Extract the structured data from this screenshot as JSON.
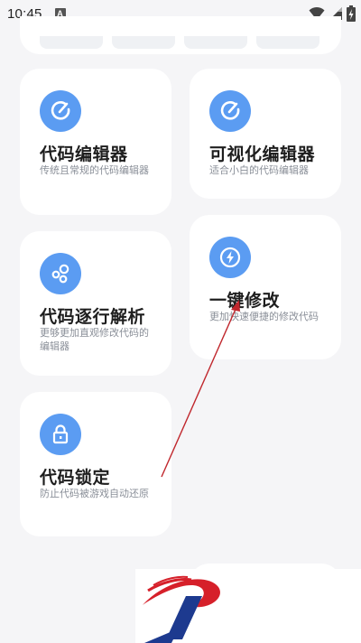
{
  "status_bar": {
    "time": "10:45",
    "notification_badge": "A",
    "icons": [
      "wifi-icon",
      "signal-icon",
      "battery-charging-icon"
    ]
  },
  "cards": [
    {
      "title": "代码编辑器",
      "description": "传统且常规的代码编辑器",
      "icon": "edit-icon"
    },
    {
      "title": "可视化编辑器",
      "description": "适合小白的代码编辑器",
      "icon": "edit-icon"
    },
    {
      "title": "代码逐行解析",
      "description": "更够更加直观修改代码的编辑器",
      "icon": "bubbles-icon"
    },
    {
      "title": "一键修改",
      "description": "更加快速便捷的修改代码",
      "icon": "lightning-icon"
    },
    {
      "title": "代码锁定",
      "description": "防止代码被游戏自动还原",
      "icon": "lock-icon"
    }
  ],
  "colors": {
    "accent": "#5b9cf2",
    "background": "#f5f5f7",
    "card": "#ffffff",
    "annotation_arrow": "#c0272d",
    "logo_red": "#d6202a",
    "logo_blue": "#1d3a8f"
  }
}
